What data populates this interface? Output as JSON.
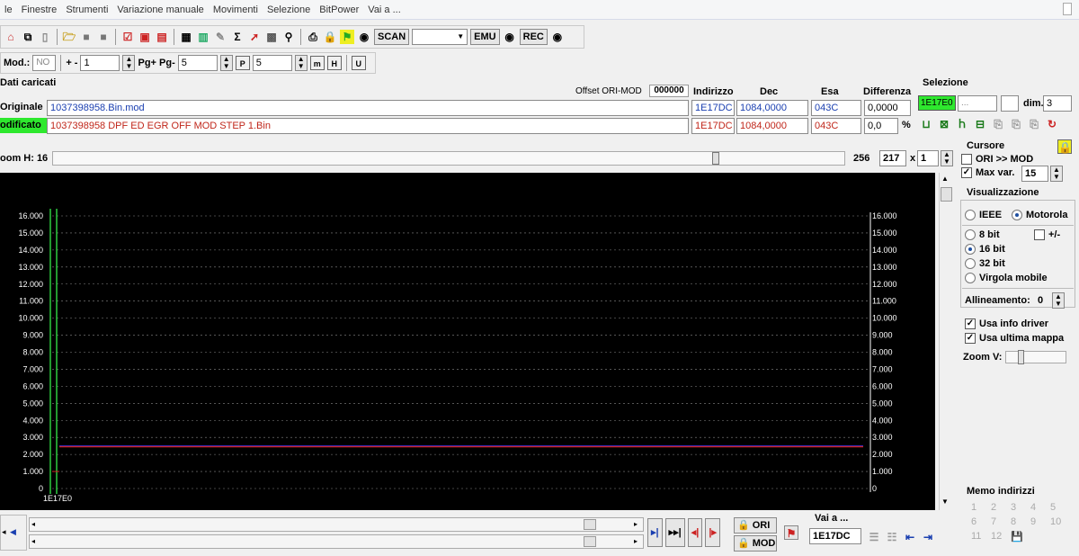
{
  "menu": [
    "le",
    "Finestre",
    "Strumenti",
    "Variazione manuale",
    "Movimenti",
    "Selezione",
    "BitPower",
    "Vai a ..."
  ],
  "toolbar": {
    "scan_label": "SCAN",
    "emu_label": "EMU",
    "rec_label": "REC",
    "scan_select_value": ""
  },
  "toolbar2": {
    "mod_label": "Mod.:",
    "mod_value": "NO",
    "plusminus_label": "+ -",
    "plusminus_value": "1",
    "pg_label": "Pg+ Pg-",
    "pg_value": "5",
    "p_value": "5"
  },
  "loaded": {
    "section_title": "Dati caricati",
    "offset_label": "Offset ORI-MOD",
    "offset_value": "000000",
    "headers": {
      "indirizzo": "Indirizzo",
      "dec": "Dec",
      "esa": "Esa",
      "diff": "Differenza"
    },
    "original": {
      "label": "Originale",
      "file": "1037398958.Bin.mod",
      "indirizzo": "1E17DC",
      "dec": "1084,0000",
      "esa": "043C",
      "diff": "0,0000"
    },
    "modified": {
      "label": "odificato",
      "file": "1037398958 DPF ED EGR OFF MOD STEP 1.Bin",
      "indirizzo": "1E17DC",
      "dec": "1084,0000",
      "esa": "043C",
      "diff": "0,0",
      "percent": "%"
    }
  },
  "selection": {
    "title": "Selezione",
    "start": "1E17E0",
    "end": "...",
    "dim_label": "dim.",
    "dim_value": "3"
  },
  "zoom": {
    "label": "oom H: 16",
    "right_value": "256",
    "width_value": "217",
    "x_label": "x",
    "mult_value": "1"
  },
  "cursor": {
    "title": "Cursore",
    "ori_mod_label": "ORI >> MOD",
    "maxvar_label": "Max var.",
    "maxvar_value": "15"
  },
  "visualizzazione": {
    "title": "Visualizzazione",
    "ieee": "IEEE",
    "motorola": "Motorola",
    "bit8": "8 bit",
    "plusminus": "+/-",
    "bit16": "16 bit",
    "bit32": "32 bit",
    "virgola": "Virgola mobile",
    "allineamento_label": "Allineamento:",
    "allineamento_value": "0",
    "usa_info": "Usa info driver",
    "usa_ultima": "Usa ultima mappa",
    "zoomv_label": "Zoom V:"
  },
  "memo": {
    "title": "Memo indirizzi",
    "items": [
      "1",
      "2",
      "3",
      "4",
      "5",
      "6",
      "7",
      "8",
      "9",
      "10",
      "11",
      "12"
    ]
  },
  "bottom": {
    "vai_label": "Vai a ...",
    "vai_value": "1E17DC",
    "ori_btn": "ORI",
    "mod_btn": "MOD"
  },
  "colors": {
    "plot_bg": "#000000",
    "ori_line": "#2c2ccf",
    "mod_line": "#cc2222",
    "cursor_line": "#2ecc40",
    "highlight_green": "#2ee82e"
  },
  "chart_data": {
    "type": "line",
    "x_start_label": "1E17E0",
    "y_ticks": [
      "16.000",
      "15.000",
      "14.000",
      "13.000",
      "12.000",
      "11.000",
      "10.000",
      "9.000",
      "8.000",
      "7.000",
      "6.000",
      "5.000",
      "4.000",
      "3.000",
      "2.000",
      "1.000",
      "0"
    ],
    "ylim": [
      0,
      16000
    ],
    "grid": true,
    "series": [
      {
        "name": "ORI",
        "values": [
          2500,
          2500
        ]
      },
      {
        "name": "MOD",
        "values": [
          2450,
          2450
        ]
      }
    ]
  }
}
